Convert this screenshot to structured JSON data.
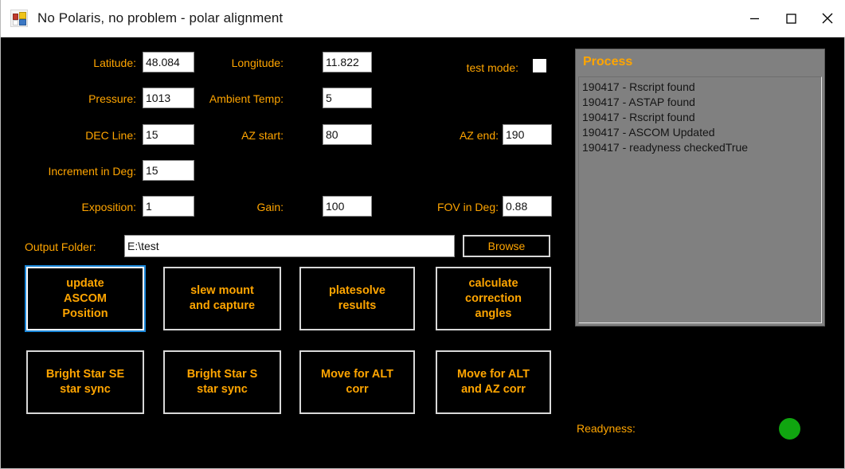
{
  "window": {
    "title": "No Polaris, no problem - polar alignment",
    "icon": "winforms-app-icon",
    "controls": {
      "minimize": "minimize-icon",
      "maximize": "maximize-icon",
      "close": "close-icon"
    }
  },
  "colors": {
    "background": "#000000",
    "label_orange": "#ffa500",
    "button_border": "#d8d8d8",
    "focus_blue": "#1a86d8",
    "panel_gray": "#808080",
    "ready_green": "#10a510"
  },
  "form": {
    "fields": [
      {
        "label": "Latitude:",
        "value": "48.084"
      },
      {
        "label": "Longitude:",
        "value": "11.822"
      },
      {
        "label": "Pressure:",
        "value": "1013"
      },
      {
        "label": "Ambient Temp:",
        "value": "5"
      },
      {
        "label": "DEC Line:",
        "value": "15"
      },
      {
        "label": "AZ start:",
        "value": "80"
      },
      {
        "label": "AZ end:",
        "value": "190"
      },
      {
        "label": "Increment in Deg:",
        "value": "15"
      },
      {
        "label": "Exposition:",
        "value": "1"
      },
      {
        "label": "Gain:",
        "value": "100"
      },
      {
        "label": "FOV in Deg:",
        "value": "0.88"
      }
    ],
    "test_mode": {
      "label": "test mode:",
      "checked": false
    },
    "output_folder": {
      "label": "Output Folder:",
      "value": "E:\\test",
      "browse_label": "Browse"
    }
  },
  "actions": {
    "row1": [
      {
        "label": "update\nASCOM\nPosition",
        "focused": true
      },
      {
        "label": "slew mount\nand capture",
        "focused": false
      },
      {
        "label": "platesolve\nresults",
        "focused": false
      },
      {
        "label": "calculate\ncorrection\nangles",
        "focused": false
      }
    ],
    "row2": [
      {
        "label": "Bright Star SE\nstar sync",
        "focused": false
      },
      {
        "label": "Bright Star S\nstar sync",
        "focused": false
      },
      {
        "label": "Move for ALT\ncorr",
        "focused": false
      },
      {
        "label": "Move for ALT\nand AZ corr",
        "focused": false
      }
    ]
  },
  "process": {
    "title": "Process",
    "entries": [
      "190417 - Rscript found",
      "190417 - ASTAP found",
      "190417 - Rscript found",
      "190417 - ASCOM Updated",
      "190417 - readyness checkedTrue"
    ]
  },
  "readyness": {
    "label": "Readyness:",
    "status": "green"
  }
}
